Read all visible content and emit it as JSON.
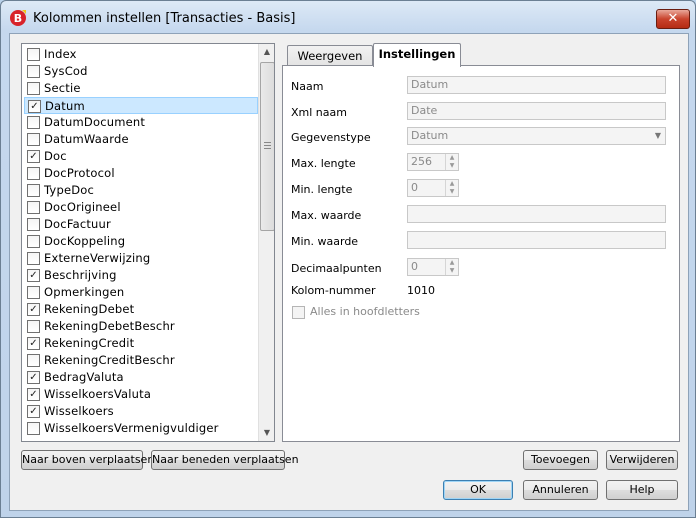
{
  "window": {
    "title": "Kolommen instellen [Transacties - Basis]",
    "close_label": "✕"
  },
  "columns": [
    {
      "label": "Index",
      "checked": false,
      "selected": false
    },
    {
      "label": "SysCod",
      "checked": false,
      "selected": false
    },
    {
      "label": "Sectie",
      "checked": false,
      "selected": false
    },
    {
      "label": "Datum",
      "checked": true,
      "selected": true
    },
    {
      "label": "DatumDocument",
      "checked": false,
      "selected": false
    },
    {
      "label": "DatumWaarde",
      "checked": false,
      "selected": false
    },
    {
      "label": "Doc",
      "checked": true,
      "selected": false
    },
    {
      "label": "DocProtocol",
      "checked": false,
      "selected": false
    },
    {
      "label": "TypeDoc",
      "checked": false,
      "selected": false
    },
    {
      "label": "DocOrigineel",
      "checked": false,
      "selected": false
    },
    {
      "label": "DocFactuur",
      "checked": false,
      "selected": false
    },
    {
      "label": "DocKoppeling",
      "checked": false,
      "selected": false
    },
    {
      "label": "ExterneVerwijzing",
      "checked": false,
      "selected": false
    },
    {
      "label": "Beschrijving",
      "checked": true,
      "selected": false
    },
    {
      "label": "Opmerkingen",
      "checked": false,
      "selected": false
    },
    {
      "label": "RekeningDebet",
      "checked": true,
      "selected": false
    },
    {
      "label": "RekeningDebetBeschr",
      "checked": false,
      "selected": false
    },
    {
      "label": "RekeningCredit",
      "checked": true,
      "selected": false
    },
    {
      "label": "RekeningCreditBeschr",
      "checked": false,
      "selected": false
    },
    {
      "label": "BedragValuta",
      "checked": true,
      "selected": false
    },
    {
      "label": "WisselkoersValuta",
      "checked": true,
      "selected": false
    },
    {
      "label": "Wisselkoers",
      "checked": true,
      "selected": false
    },
    {
      "label": "WisselkoersVermenigvuldiger",
      "checked": false,
      "selected": false
    }
  ],
  "tabs": {
    "weergeven": "Weergeven",
    "instellingen": "Instellingen",
    "active": "Instellingen"
  },
  "form": {
    "naam": {
      "label": "Naam",
      "value": "Datum"
    },
    "xml_naam": {
      "label": "Xml naam",
      "value": "Date"
    },
    "gegevenstype": {
      "label": "Gegevenstype",
      "value": "Datum"
    },
    "max_lengte": {
      "label": "Max. lengte",
      "value": "256"
    },
    "min_lengte": {
      "label": "Min. lengte",
      "value": "0"
    },
    "max_waarde": {
      "label": "Max. waarde",
      "value": ""
    },
    "min_waarde": {
      "label": "Min. waarde",
      "value": ""
    },
    "decimaalpunten": {
      "label": "Decimaalpunten",
      "value": "0"
    },
    "kolom_nummer": {
      "label": "Kolom-nummer",
      "value": "1010"
    },
    "hoofdletters": {
      "label": "Alles in hoofdletters",
      "checked": false
    }
  },
  "buttons": {
    "move_up": "Naar boven verplaatsen",
    "move_down": "Naar beneden verplaatsen",
    "add": "Toevoegen",
    "remove": "Verwijderen",
    "ok": "OK",
    "cancel": "Annuleren",
    "help": "Help"
  },
  "colors": {
    "selection": "#cce8ff",
    "close": "#c9432d",
    "window_frame": "#c5d8ee"
  },
  "icons": {
    "app": "banana-app-icon",
    "close": "close-icon",
    "check": "checkmark-icon"
  }
}
